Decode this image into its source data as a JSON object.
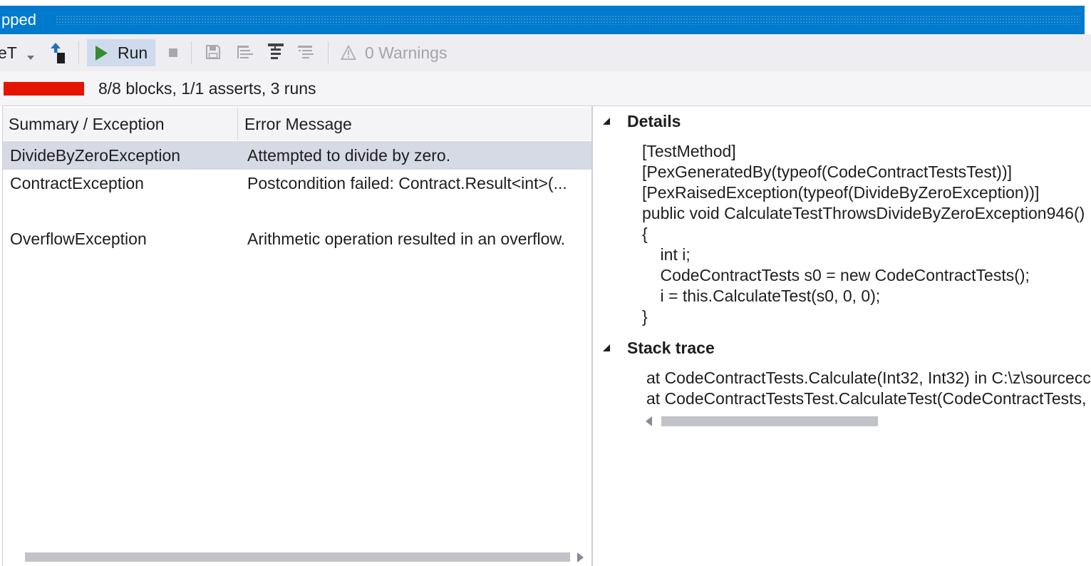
{
  "window": {
    "title": "pped"
  },
  "toolbar": {
    "dropdown_value": "eT",
    "run_label": "Run",
    "warnings_label": "0 Warnings",
    "icons": {
      "dropdown": "chevron-down-icon",
      "go_to": "go-to-source-icon",
      "run": "play-icon",
      "stop": "stop-icon",
      "save": "save-icon",
      "list_a": "list-lines-icon",
      "list_b": "tree-lines-icon",
      "list_c": "indent-lines-icon",
      "warnings": "warning-icon"
    }
  },
  "progress": {
    "summary": "8/8 blocks, 1/1 asserts, 3 runs"
  },
  "results": {
    "columns": {
      "summary": "Summary / Exception",
      "message": "Error Message"
    },
    "rows": [
      {
        "summary": "DivideByZeroException",
        "message": "Attempted to divide by zero.",
        "selected": true
      },
      {
        "summary": "ContractException",
        "message": "Postcondition failed: Contract.Result<int>(...",
        "selected": false
      },
      {
        "summary": "OverflowException",
        "message": "Arithmetic operation resulted in an overflow.",
        "selected": false
      }
    ]
  },
  "details": {
    "heading": "Details",
    "expanded": true,
    "code_lines": [
      "[TestMethod]",
      "[PexGeneratedBy(typeof(CodeContractTestsTest))]",
      "[PexRaisedException(typeof(DivideByZeroException))]",
      "public void CalculateTestThrowsDivideByZeroException946()",
      "{",
      "    int i;",
      "    CodeContractTests s0 = new CodeContractTests();",
      "    i = this.CalculateTest(s0, 0, 0);",
      "}"
    ]
  },
  "stack_trace": {
    "heading": "Stack trace",
    "expanded": true,
    "lines": [
      "at CodeContractTests.Calculate(Int32, Int32) in C:\\z\\sourcecc",
      "at CodeContractTestsTest.CalculateTest(CodeContractTests,"
    ]
  },
  "colors": {
    "title_bar": "#007ACC",
    "toolbar_background": "#EEEEF2",
    "progress_bar": "#E51400",
    "run_icon": "#388A34",
    "selected_row": "#D6DAE5"
  }
}
